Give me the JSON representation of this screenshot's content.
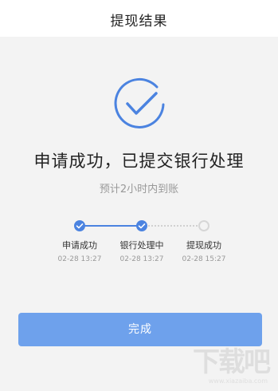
{
  "header": {
    "title": "提现结果"
  },
  "result": {
    "icon": "check-circle-icon",
    "headline": "申请成功，已提交银行处理",
    "subline": "预计2小时内到账"
  },
  "steps": [
    {
      "label": "申请成功",
      "time": "02-28 13:27",
      "status": "done"
    },
    {
      "label": "银行处理中",
      "time": "02-28 13:27",
      "status": "done"
    },
    {
      "label": "提现成功",
      "time": "02-28 15:27",
      "status": "pending"
    }
  ],
  "actions": {
    "done_label": "完成"
  },
  "watermark": {
    "main": "下载吧",
    "sub": "www.xiazaiba.com"
  },
  "colors": {
    "accent": "#4b83e0",
    "button": "#6ea1ec",
    "background": "#f3f3f3"
  }
}
